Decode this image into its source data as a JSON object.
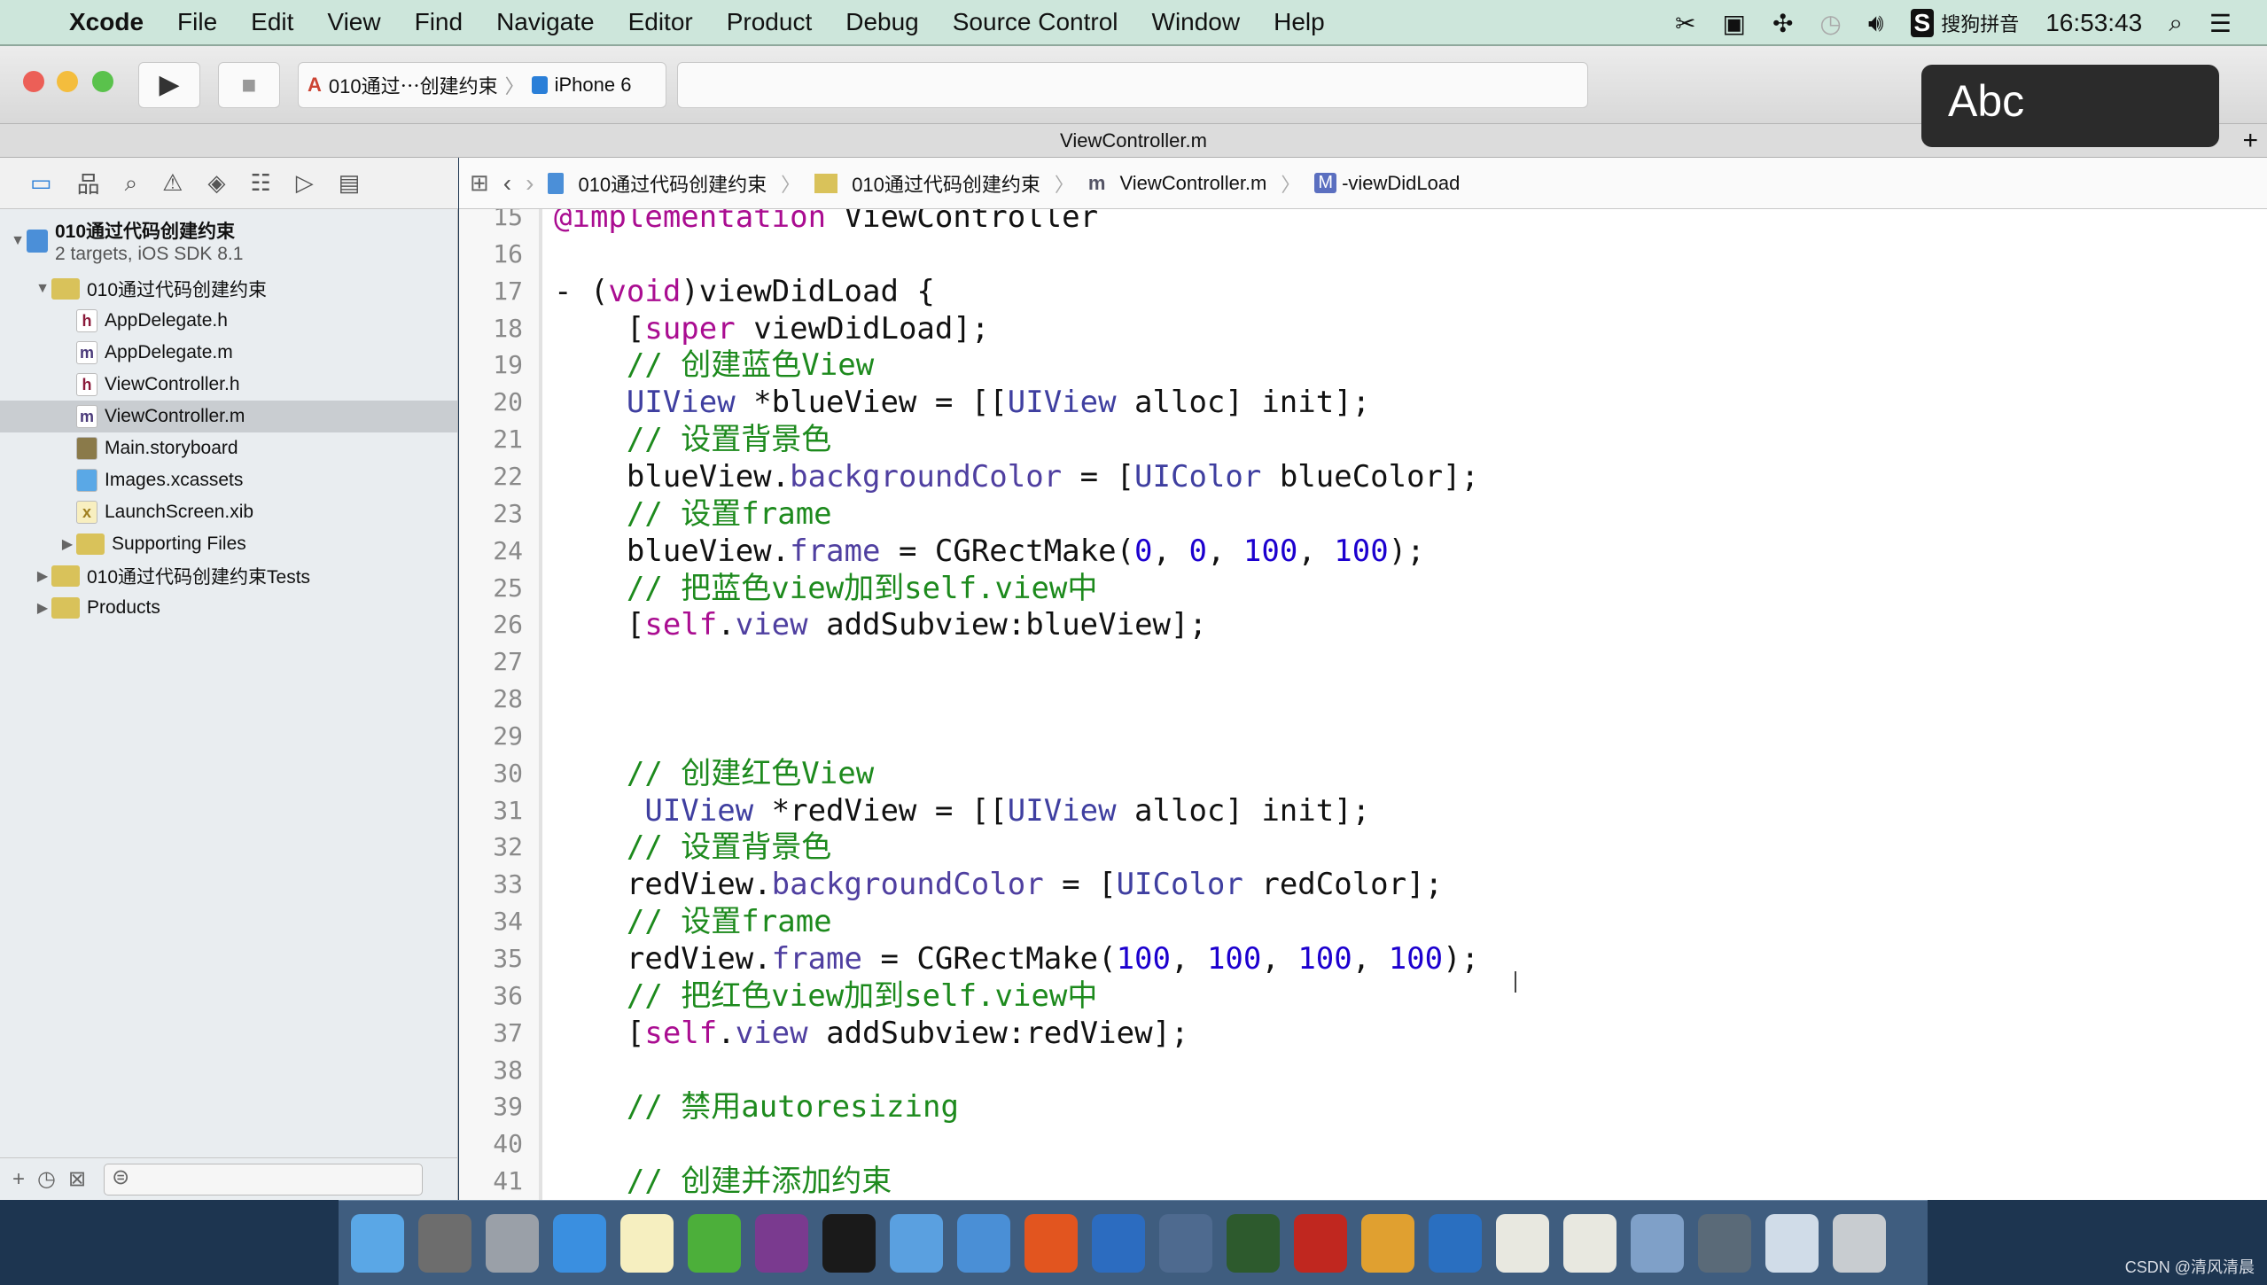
{
  "menubar": {
    "app": "Xcode",
    "items": [
      "File",
      "Edit",
      "View",
      "Find",
      "Navigate",
      "Editor",
      "Product",
      "Debug",
      "Source Control",
      "Window",
      "Help"
    ],
    "input_method": "搜狗拼音",
    "clock": "16:53:43"
  },
  "toolbar": {
    "scheme": "010通过⋯创建约束",
    "device": "iPhone 6"
  },
  "tab": {
    "title": "ViewController.m"
  },
  "jumpbar": {
    "items": [
      "010通过代码创建约束",
      "010通过代码创建约束",
      "ViewController.m",
      "-viewDidLoad"
    ]
  },
  "sidebar": {
    "items": [
      {
        "label": "010通过代码创建约束",
        "sub": "2 targets, iOS SDK 8.1",
        "kind": "project",
        "depth": 0,
        "disc": "▼"
      },
      {
        "label": "010通过代码创建约束",
        "kind": "folder",
        "depth": 1,
        "disc": "▼"
      },
      {
        "label": "AppDelegate.h",
        "kind": "h",
        "depth": 2
      },
      {
        "label": "AppDelegate.m",
        "kind": "m",
        "depth": 2
      },
      {
        "label": "ViewController.h",
        "kind": "h",
        "depth": 2
      },
      {
        "label": "ViewController.m",
        "kind": "m",
        "depth": 2,
        "selected": true
      },
      {
        "label": "Main.storyboard",
        "kind": "storyboard",
        "depth": 2
      },
      {
        "label": "Images.xcassets",
        "kind": "xcassets",
        "depth": 2
      },
      {
        "label": "LaunchScreen.xib",
        "kind": "xib",
        "depth": 2
      },
      {
        "label": "Supporting Files",
        "kind": "folder",
        "depth": 2,
        "disc": "▶"
      },
      {
        "label": "010通过代码创建约束Tests",
        "kind": "folder",
        "depth": 1,
        "disc": "▶"
      },
      {
        "label": "Products",
        "kind": "folder",
        "depth": 1,
        "disc": "▶"
      }
    ]
  },
  "code": [
    {
      "n": "15",
      "t": [
        [
          "k",
          "@implementation"
        ],
        [
          "pl",
          " ViewController"
        ]
      ]
    },
    {
      "n": "16",
      "t": []
    },
    {
      "n": "17",
      "t": [
        [
          "pl",
          "- ("
        ],
        [
          "k",
          "void"
        ],
        [
          "pl",
          ")viewDidLoad {"
        ]
      ]
    },
    {
      "n": "18",
      "t": [
        [
          "pl",
          "    ["
        ],
        [
          "k",
          "super"
        ],
        [
          "pl",
          " viewDidLoad];"
        ]
      ]
    },
    {
      "n": "19",
      "t": [
        [
          "c",
          "    // 创建蓝色View"
        ]
      ]
    },
    {
      "n": "20",
      "t": [
        [
          "t",
          "    UIView"
        ],
        [
          "pl",
          " *blueView = [["
        ],
        [
          "t",
          "UIView"
        ],
        [
          "pl",
          " alloc] init];"
        ]
      ]
    },
    {
      "n": "21",
      "t": [
        [
          "c",
          "    // 设置背景色"
        ]
      ]
    },
    {
      "n": "22",
      "t": [
        [
          "pl",
          "    blueView."
        ],
        [
          "p",
          "backgroundColor"
        ],
        [
          "pl",
          " = ["
        ],
        [
          "t",
          "UIColor"
        ],
        [
          "pl",
          " blueColor];"
        ]
      ]
    },
    {
      "n": "23",
      "t": [
        [
          "c",
          "    // 设置frame"
        ]
      ]
    },
    {
      "n": "24",
      "t": [
        [
          "pl",
          "    blueView."
        ],
        [
          "p",
          "frame"
        ],
        [
          "pl",
          " = CGRectMake("
        ],
        [
          "n",
          "0"
        ],
        [
          "pl",
          ", "
        ],
        [
          "n",
          "0"
        ],
        [
          "pl",
          ", "
        ],
        [
          "n",
          "100"
        ],
        [
          "pl",
          ", "
        ],
        [
          "n",
          "100"
        ],
        [
          "pl",
          ");"
        ]
      ]
    },
    {
      "n": "25",
      "t": [
        [
          "c",
          "    // 把蓝色view加到self.view中"
        ]
      ]
    },
    {
      "n": "26",
      "t": [
        [
          "pl",
          "    ["
        ],
        [
          "k",
          "self"
        ],
        [
          "pl",
          "."
        ],
        [
          "p",
          "view"
        ],
        [
          "pl",
          " addSubview:blueView];"
        ]
      ]
    },
    {
      "n": "27",
      "t": []
    },
    {
      "n": "28",
      "t": []
    },
    {
      "n": "29",
      "t": []
    },
    {
      "n": "30",
      "t": [
        [
          "c",
          "    // 创建红色View"
        ]
      ]
    },
    {
      "n": "31",
      "t": [
        [
          "t",
          "     UIView"
        ],
        [
          "pl",
          " *redView = [["
        ],
        [
          "t",
          "UIView"
        ],
        [
          "pl",
          " alloc] init];"
        ]
      ]
    },
    {
      "n": "32",
      "t": [
        [
          "c",
          "    // 设置背景色"
        ]
      ]
    },
    {
      "n": "33",
      "t": [
        [
          "pl",
          "    redView."
        ],
        [
          "p",
          "backgroundColor"
        ],
        [
          "pl",
          " = ["
        ],
        [
          "t",
          "UIColor"
        ],
        [
          "pl",
          " redColor];"
        ]
      ]
    },
    {
      "n": "34",
      "t": [
        [
          "c",
          "    // 设置frame"
        ]
      ]
    },
    {
      "n": "35",
      "t": [
        [
          "pl",
          "    redView."
        ],
        [
          "p",
          "frame"
        ],
        [
          "pl",
          " = CGRectMake("
        ],
        [
          "n",
          "100"
        ],
        [
          "pl",
          ", "
        ],
        [
          "n",
          "100"
        ],
        [
          "pl",
          ", "
        ],
        [
          "n",
          "100"
        ],
        [
          "pl",
          ", "
        ],
        [
          "n",
          "100"
        ],
        [
          "pl",
          ");"
        ]
      ]
    },
    {
      "n": "36",
      "t": [
        [
          "c",
          "    // 把红色view加到self.view中"
        ]
      ]
    },
    {
      "n": "37",
      "t": [
        [
          "pl",
          "    ["
        ],
        [
          "k",
          "self"
        ],
        [
          "pl",
          "."
        ],
        [
          "p",
          "view"
        ],
        [
          "pl",
          " addSubview:redView];"
        ]
      ]
    },
    {
      "n": "38",
      "t": []
    },
    {
      "n": "39",
      "t": [
        [
          "c",
          "    // 禁用autoresizing"
        ]
      ]
    },
    {
      "n": "40",
      "t": []
    },
    {
      "n": "41",
      "t": [
        [
          "c",
          "    // 创建并添加约束"
        ]
      ]
    }
  ],
  "overlay": {
    "text": "Abc"
  },
  "dock": {
    "icons": [
      {
        "name": "finder",
        "color": "#5aa7e6"
      },
      {
        "name": "system-preferences",
        "color": "#6d6d6d"
      },
      {
        "name": "launchpad",
        "color": "#9aa0a8"
      },
      {
        "name": "safari",
        "color": "#3a8fe0"
      },
      {
        "name": "notes",
        "color": "#f6efc0"
      },
      {
        "name": "xmind",
        "color": "#4caf3a"
      },
      {
        "name": "onenote",
        "color": "#7a3a8f"
      },
      {
        "name": "terminal",
        "color": "#1a1a1a"
      },
      {
        "name": "xcode",
        "color": "#5aa0e0"
      },
      {
        "name": "sketch-folder",
        "color": "#4a8fd6"
      },
      {
        "name": "pages",
        "color": "#e2551f"
      },
      {
        "name": "screenshot",
        "color": "#2c6cc0"
      },
      {
        "name": "movie",
        "color": "#4e6a8f"
      },
      {
        "name": "ftp",
        "color": "#2d5a2d"
      },
      {
        "name": "filezilla",
        "color": "#c0271f"
      },
      {
        "name": "tool",
        "color": "#e0a030"
      },
      {
        "name": "word",
        "color": "#2a6fc0"
      },
      {
        "name": "app-a1",
        "color": "#e8e8e0"
      },
      {
        "name": "app-a2",
        "color": "#e8e8e0"
      },
      {
        "name": "preview",
        "color": "#7fa0c8"
      },
      {
        "name": "screen",
        "color": "#5a6a78"
      },
      {
        "name": "document",
        "color": "#d0dce8"
      },
      {
        "name": "trash",
        "color": "#c8ccd0"
      }
    ]
  },
  "watermark": "CSDN @清风清晨",
  "colors": {
    "menubar": "#cde6db",
    "keyword": "#aa0d91",
    "comment": "#1d8a1d",
    "number": "#1c00cf",
    "type": "#3f3fa0"
  }
}
